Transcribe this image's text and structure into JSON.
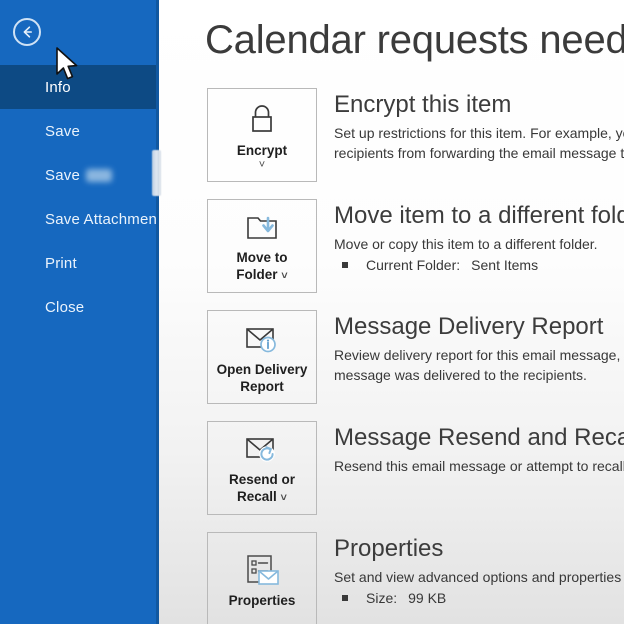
{
  "sidebar": {
    "back_button": "back-arrow",
    "items": [
      {
        "label": "Info",
        "selected": true,
        "blurred": false
      },
      {
        "label": "Save",
        "selected": false,
        "blurred": false
      },
      {
        "label": "Save",
        "selected": false,
        "blurred": true
      },
      {
        "label": "Save Attachments",
        "selected": false,
        "blurred": false
      },
      {
        "label": "Print",
        "selected": false,
        "blurred": false
      },
      {
        "label": "Close",
        "selected": false,
        "blurred": false
      }
    ]
  },
  "main": {
    "title": "Calendar requests need",
    "sections": [
      {
        "button_label": "Encrypt",
        "icon": "lock-icon",
        "has_chevron": true,
        "chevron_position": "below",
        "title": "Encrypt this item",
        "desc_line1": "Set up restrictions for this item. For example, you",
        "desc_line2": "recipients from forwarding the email message to",
        "bullet": null
      },
      {
        "button_label": "Move to\nFolder",
        "icon": "move-to-folder-icon",
        "has_chevron": true,
        "chevron_position": "inline",
        "title": "Move item to a different folder",
        "desc_line1": "Move or copy this item to a different folder.",
        "desc_line2": null,
        "bullet": {
          "key": "Current Folder:",
          "value": "Sent Items"
        }
      },
      {
        "button_label": "Open Delivery\nReport",
        "icon": "envelope-info-icon",
        "has_chevron": false,
        "chevron_position": null,
        "title": "Message Delivery Report",
        "desc_line1": "Review delivery report for this email message, incl",
        "desc_line2": "message was delivered to the recipients.",
        "bullet": null
      },
      {
        "button_label": "Resend or\nRecall",
        "icon": "envelope-resend-icon",
        "has_chevron": true,
        "chevron_position": "inline",
        "title": "Message Resend and Recall",
        "desc_line1": "Resend this email message or attempt to recall it",
        "desc_line2": null,
        "bullet": null
      },
      {
        "button_label": "Properties",
        "icon": "properties-icon",
        "has_chevron": false,
        "chevron_position": null,
        "title": "Properties",
        "desc_line1": "Set and view advanced options and properties fo",
        "desc_line2": null,
        "bullet": {
          "key": "Size:",
          "value": "99 KB"
        }
      }
    ]
  },
  "cursor": {
    "type": "arrow-pointer"
  },
  "colors": {
    "sidebar_blue": "#1668bf",
    "sidebar_selected": "#0d4a84",
    "accent_icon_blue": "#86b9dd",
    "title_gray": "#3c3c3c"
  }
}
